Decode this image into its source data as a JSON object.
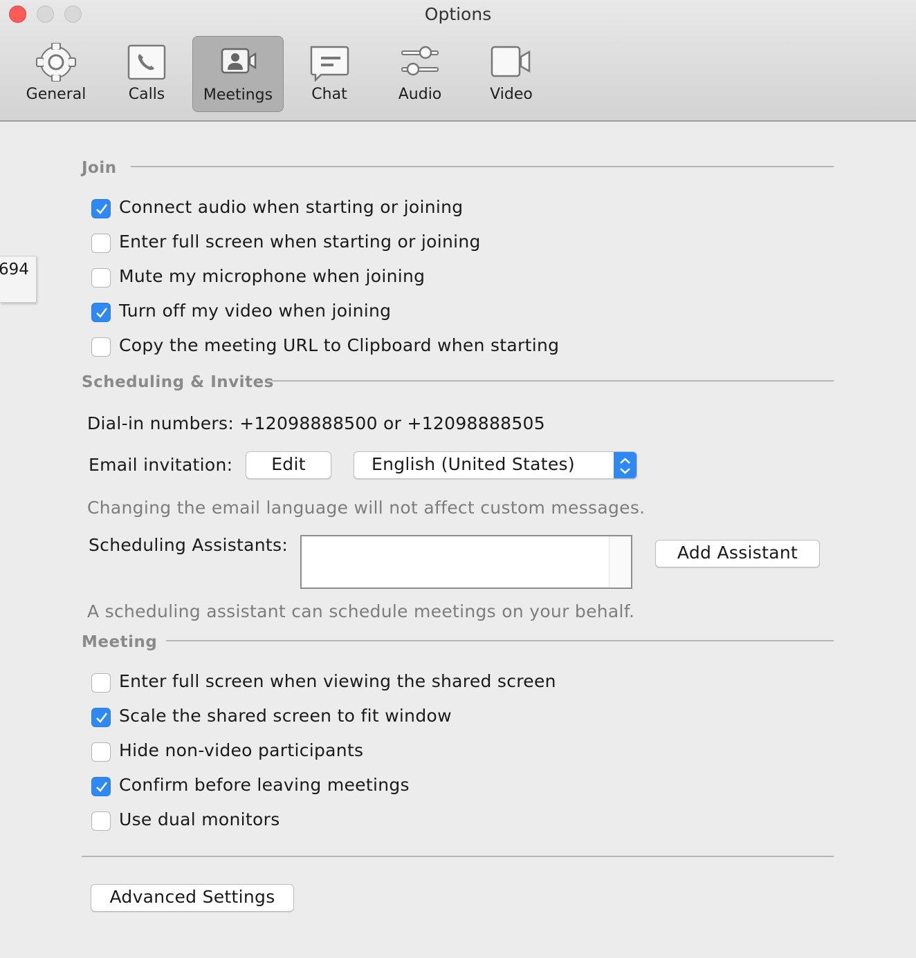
{
  "window": {
    "title": "Options"
  },
  "tabs": [
    {
      "label": "General",
      "icon": "gear-icon"
    },
    {
      "label": "Calls",
      "icon": "phone-icon"
    },
    {
      "label": "Meetings",
      "icon": "meeting-icon",
      "active": true
    },
    {
      "label": "Chat",
      "icon": "chat-icon"
    },
    {
      "label": "Audio",
      "icon": "sliders-icon"
    },
    {
      "label": "Video",
      "icon": "video-camera-icon"
    }
  ],
  "side_tab": {
    "text": "694"
  },
  "join": {
    "title": "Join",
    "options": [
      {
        "label": "Connect audio when starting or joining",
        "checked": true
      },
      {
        "label": "Enter full screen when starting or joining",
        "checked": false
      },
      {
        "label": "Mute my microphone when joining",
        "checked": false
      },
      {
        "label": "Turn off my video when joining",
        "checked": true
      },
      {
        "label": "Copy the meeting URL to Clipboard when starting",
        "checked": false
      }
    ]
  },
  "scheduling": {
    "title": "Scheduling & Invites",
    "dial_in": "Dial-in numbers: +12098888500 or +12098888505",
    "email_label": "Email invitation:",
    "edit_button": "Edit",
    "language": "English (United States)",
    "language_note": "Changing the email language will not affect custom messages.",
    "assistants_label": "Scheduling Assistants:",
    "add_assistant_button": "Add Assistant",
    "assistant_note": "A scheduling assistant can schedule meetings on your behalf."
  },
  "meeting": {
    "title": "Meeting",
    "options": [
      {
        "label": "Enter full screen when viewing the shared screen",
        "checked": false
      },
      {
        "label": "Scale the shared screen to fit window",
        "checked": true
      },
      {
        "label": "Hide non-video participants",
        "checked": false
      },
      {
        "label": "Confirm before leaving meetings",
        "checked": true
      },
      {
        "label": "Use dual monitors",
        "checked": false
      }
    ]
  },
  "advanced_button": "Advanced Settings",
  "colors": {
    "accent": "#2f89f5",
    "close": "#fc5b57"
  }
}
